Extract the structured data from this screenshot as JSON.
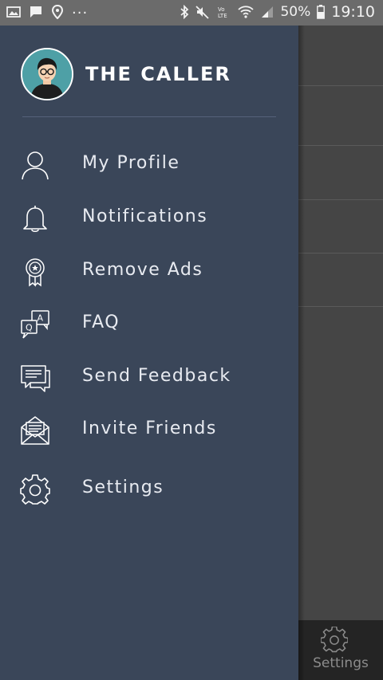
{
  "status_bar": {
    "ellipsis": "...",
    "battery": "50%",
    "time": "19:10",
    "icons": [
      "image-icon",
      "message-icon",
      "location-icon",
      "bluetooth-icon",
      "mute-icon",
      "volte-icon",
      "wifi-icon",
      "signal-icon",
      "battery-icon"
    ]
  },
  "drawer": {
    "app_name": "THE CALLER",
    "background_color": "#3a4659",
    "items": [
      {
        "label": "My Profile",
        "icon": "user-icon"
      },
      {
        "label": "Notifications",
        "icon": "bell-icon"
      },
      {
        "label": "Remove Ads",
        "icon": "award-icon"
      },
      {
        "label": "FAQ",
        "icon": "qa-icon"
      },
      {
        "label": "Send Feedback",
        "icon": "feedback-icon"
      },
      {
        "label": "Invite Friends",
        "icon": "envelope-icon"
      },
      {
        "label": "Settings",
        "icon": "gear-icon"
      }
    ]
  },
  "bottom_nav": {
    "settings_label": "Settings",
    "icon": "gear-icon"
  }
}
